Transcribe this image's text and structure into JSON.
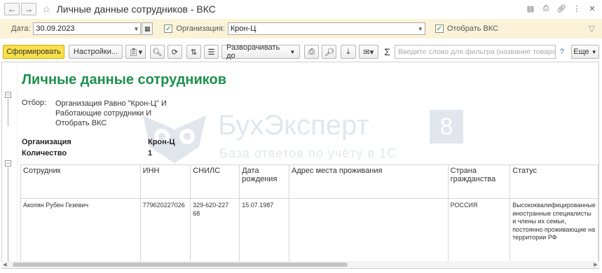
{
  "window": {
    "title": "Личные данные сотрудников - ВКС",
    "icons": [
      "save-icon",
      "print-icon",
      "link-icon",
      "more-icon",
      "close-icon"
    ]
  },
  "filters": {
    "date_label": "Дата:",
    "date_value": "30.09.2023",
    "org_label": "Организация:",
    "org_value": "Крон-Ц",
    "vks_label": "Отобрать ВКС",
    "org_checked": true,
    "vks_checked": true
  },
  "toolbar": {
    "generate": "Сформировать",
    "settings": "Настройки...",
    "expand": "Разворачивать до",
    "search_placeholder": "Введите слово для фильтра (название товара, покупат...",
    "sigma": "Σ",
    "help": "?",
    "more": "Еще"
  },
  "report": {
    "title": "Личные данные сотрудников",
    "otbor_label": "Отбор:",
    "otbor_lines": [
      "Организация Равно \"Крон-Ц\" И",
      "Работающие сотрудники И",
      "Отобрать ВКС"
    ],
    "group_org_label": "Организация",
    "group_org_value": "Крон-Ц",
    "group_count_label": "Количество",
    "group_count_value": "1",
    "columns": [
      "Сотрудник",
      "ИНН",
      "СНИЛС",
      "Дата рождения",
      "Адрес места проживания",
      "Страна гражданства",
      "Статус"
    ],
    "rows": [
      {
        "employee": "Акопян Рубен Гезевич",
        "inn": "779620227026",
        "snils": "329-620-227 68",
        "birth": "15.07.1987",
        "address": "",
        "country": "РОССИЯ",
        "status": "Высококвалифицированные иностранные специалисты и члены их семьи, постоянно проживающие на территории РФ"
      }
    ]
  },
  "watermark": {
    "brand": "БухЭксперт",
    "number": "8",
    "subtitle": "База ответов по учёту в 1С"
  }
}
